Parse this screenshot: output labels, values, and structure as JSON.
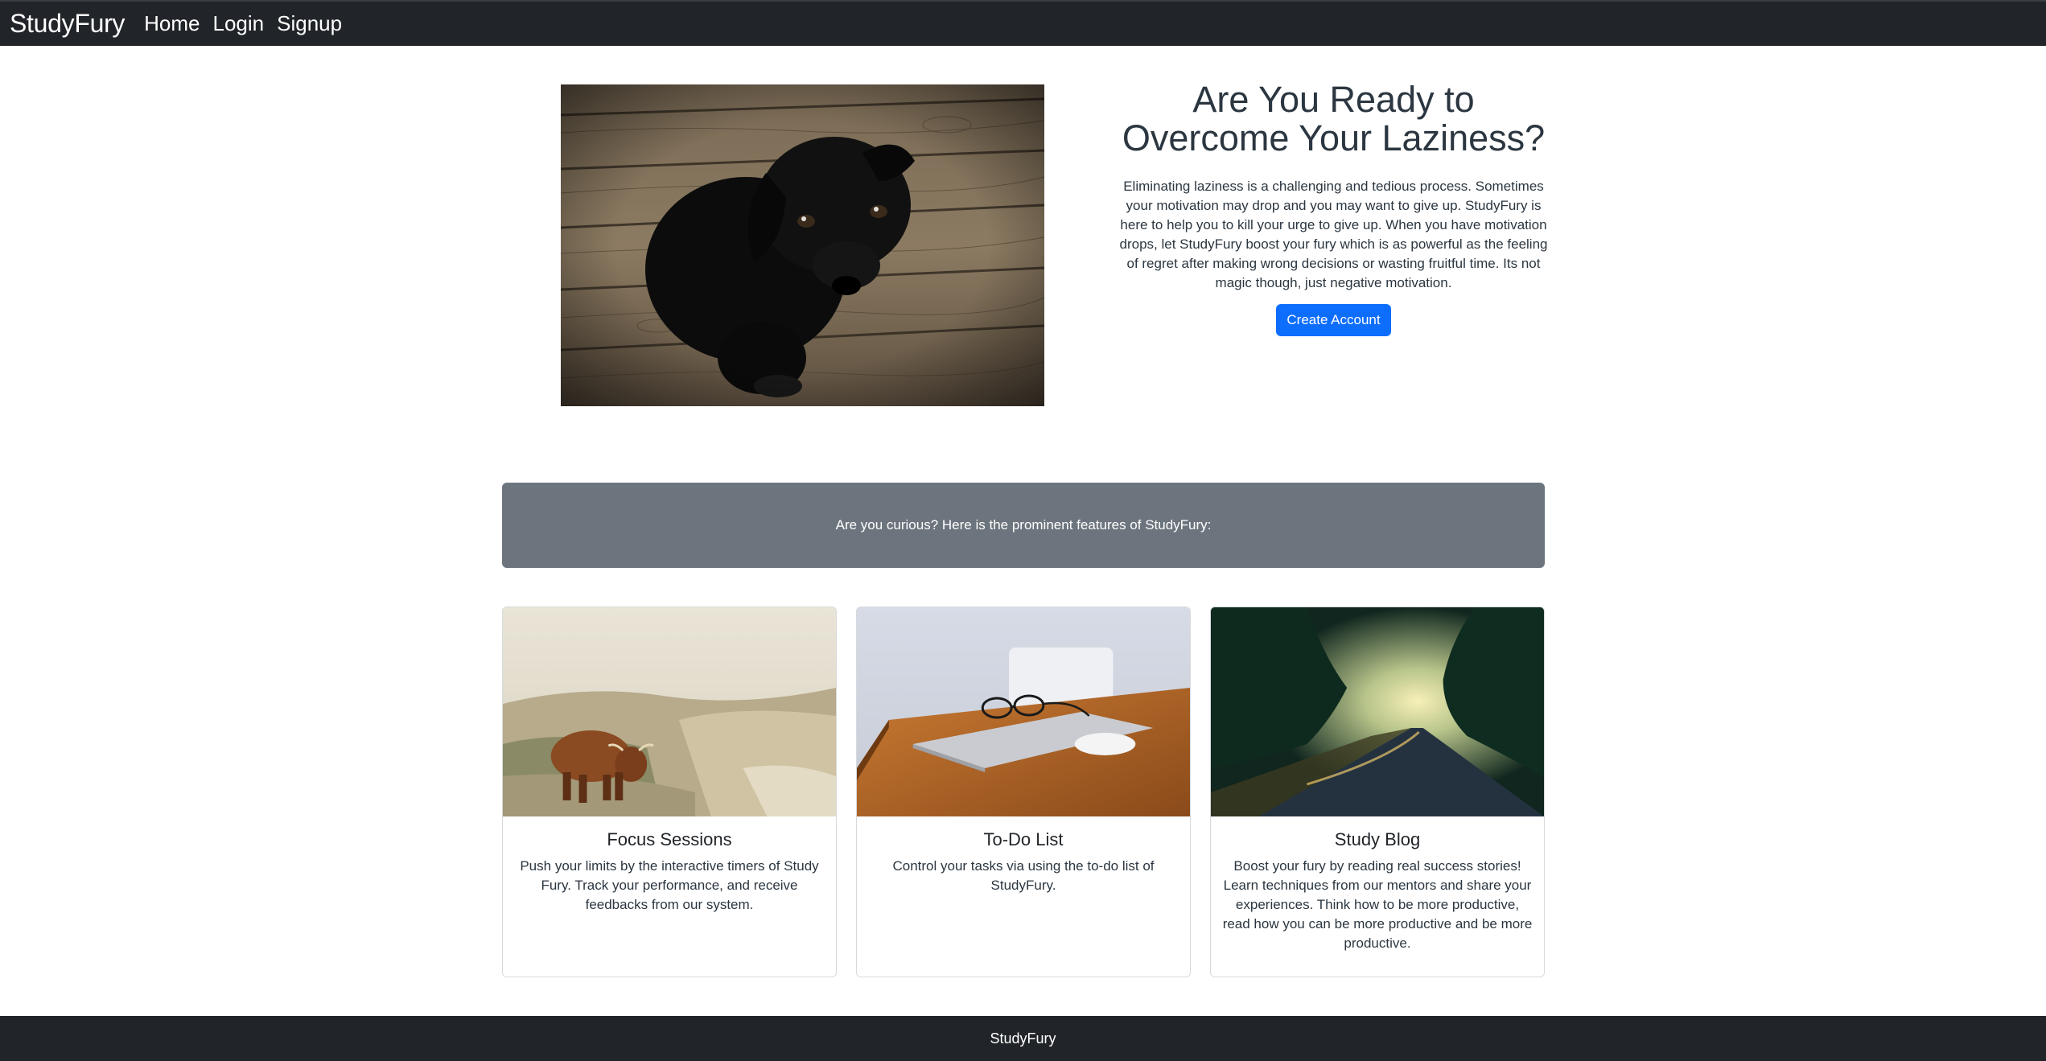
{
  "navbar": {
    "brand": "StudyFury",
    "links": [
      "Home",
      "Login",
      "Signup"
    ]
  },
  "hero": {
    "title": "Are You Ready to Overcome Your Laziness?",
    "description": "Eliminating laziness is a challenging and tedious process. Sometimes your motivation may drop and you may want to give up. StudyFury is here to help you to kill your urge to give up. When you have motivation drops, let StudyFury boost your fury which is as powerful as the feeling of regret after making wrong decisions or wasting fruitful time. Its not magic though, just negative motivation.",
    "button_label": "Create Account"
  },
  "features": {
    "banner_text": "Are you curious? Here is the prominent features of StudyFury:",
    "cards": [
      {
        "title": "Focus Sessions",
        "text": "Push your limits by the interactive timers of Study Fury. Track your performance, and receive feedbacks from our system."
      },
      {
        "title": "To-Do List",
        "text": "Control your tasks via using the to-do list of StudyFury."
      },
      {
        "title": "Study Blog",
        "text": "Boost your fury by reading real success stories! Learn techniques from our mentors and share your experiences. Think how to be more productive, read how you can be more productive and be more productive."
      }
    ]
  },
  "footer": {
    "text": "StudyFury"
  },
  "colors": {
    "navbar_bg": "#212529",
    "primary": "#0d6efd",
    "banner_bg": "#6c757d"
  }
}
